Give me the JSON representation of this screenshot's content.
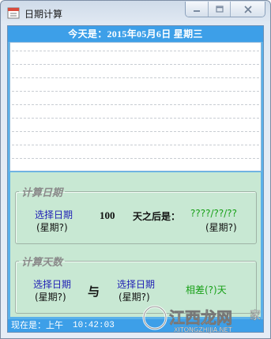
{
  "window": {
    "title": "日期计算",
    "icons": {
      "app": "calendar-icon",
      "minimize": "minimize-icon",
      "maximize": "maximize-icon",
      "close": "close-icon"
    }
  },
  "header": {
    "today_text": "今天是：2015年05月6日  星期三"
  },
  "calc_date": {
    "legend": "计算日期",
    "select_label": "选择日期",
    "weekday_placeholder": "(星期?)",
    "days_value": "100",
    "after_label": "天之后是：",
    "result_date": "????/??/??",
    "result_weekday": "(星期?)"
  },
  "calc_days": {
    "legend": "计算天数",
    "select_label_1": "选择日期",
    "weekday_1": "(星期?)",
    "and_label": "与",
    "select_label_2": "选择日期",
    "weekday_2": "(星期?)",
    "diff_label": "相差(?)天"
  },
  "status": {
    "now_label": "现在是：上午",
    "time": "10:42:03"
  },
  "watermark": {
    "text_main": "江西龙网",
    "text_sub": "XITONGZHIJIA.NET",
    "text_corner": "家"
  },
  "colors": {
    "header_blue": "#3d9fe8",
    "panel_green": "#c8e8d3",
    "link_blue": "#1f1fb5",
    "result_green": "#17a017"
  }
}
